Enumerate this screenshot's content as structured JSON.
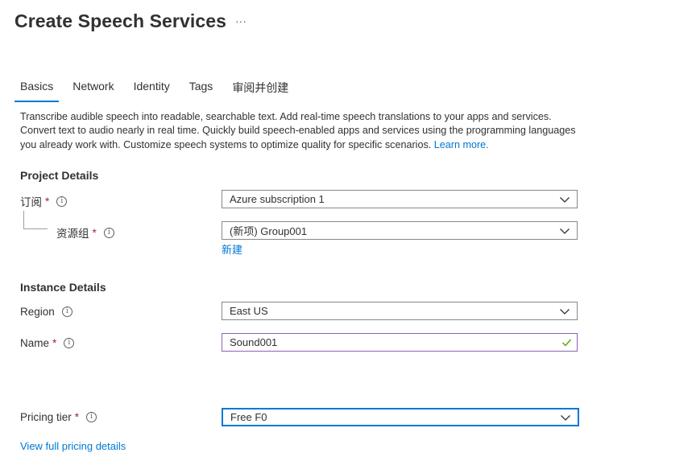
{
  "page": {
    "title": "Create Speech Services",
    "more_label": "···"
  },
  "tabs": [
    {
      "label": "Basics",
      "active": true
    },
    {
      "label": "Network",
      "active": false
    },
    {
      "label": "Identity",
      "active": false
    },
    {
      "label": "Tags",
      "active": false
    },
    {
      "label": "审阅并创建",
      "active": false
    }
  ],
  "description": {
    "text": "Transcribe audible speech into readable, searchable text. Add real-time speech translations to your apps and services. Convert text to audio nearly in real time. Quickly build speech-enabled apps and services using the programming languages you already work with. Customize speech systems to optimize quality for specific scenarios.",
    "link": "Learn more."
  },
  "project_details": {
    "heading": "Project Details",
    "subscription": {
      "label": "订阅",
      "required": "*",
      "value": "Azure subscription 1"
    },
    "resource_group": {
      "label": "资源组",
      "required": "*",
      "value": "(新项) Group001",
      "create_new": "新建"
    }
  },
  "instance_details": {
    "heading": "Instance Details",
    "region": {
      "label": "Region",
      "value": "East US"
    },
    "name": {
      "label": "Name",
      "required": "*",
      "value": "Sound001"
    }
  },
  "pricing": {
    "label": "Pricing tier",
    "required": "*",
    "value": "Free F0",
    "details_link": "View full pricing details"
  },
  "icons": {
    "info": "info-icon",
    "dropdown": "chevron-down-icon",
    "valid": "checkmark-icon"
  },
  "colors": {
    "accent": "#0078d4",
    "required": "#a4262c",
    "valid_border": "#8764b8",
    "valid_check": "#57a300"
  }
}
